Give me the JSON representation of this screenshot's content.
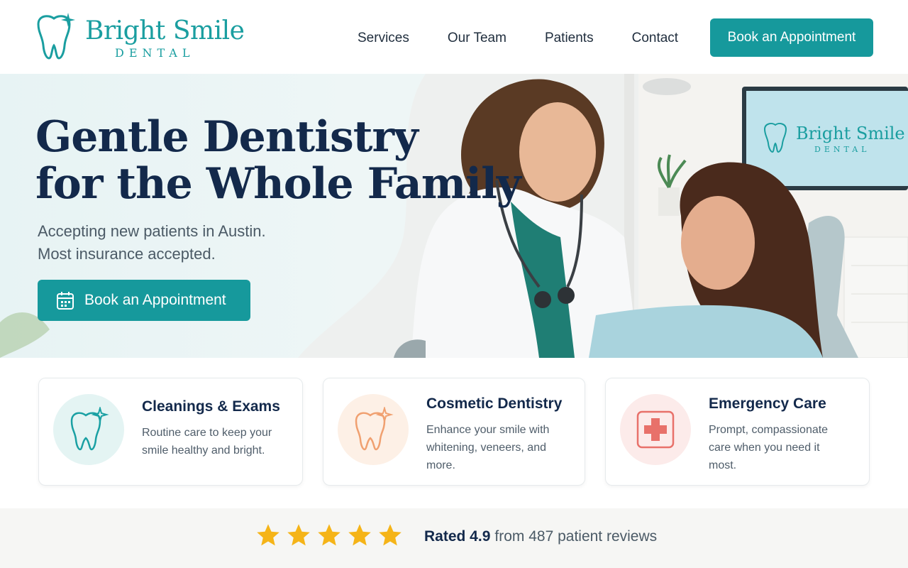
{
  "brand": {
    "name": "Bright Smile",
    "sub": "DENTAL",
    "accent": "#16999c"
  },
  "nav": {
    "items": [
      "Services",
      "Our Team",
      "Patients",
      "Contact"
    ],
    "cta": "Book an Appointment"
  },
  "hero": {
    "title_line1": "Gentle Dentistry",
    "title_line2": "for the Whole Family",
    "sub_line1": "Accepting new patients in Austin.",
    "sub_line2": "Most insurance accepted.",
    "cta": "Book an Appointment",
    "monitor_brand": "Bright Smile",
    "monitor_sub": "DENTAL"
  },
  "services": [
    {
      "title": "Cleanings & Exams",
      "desc_line1": "Routine care to keep your",
      "desc_line2": "smile healthy and bright.",
      "desc_line3": "",
      "icon": "tooth-sparkle-icon",
      "color": "#1aa0a3",
      "bg": "#e4f4f3"
    },
    {
      "title": "Cosmetic Dentistry",
      "desc_line1": "Enhance your smile with",
      "desc_line2": "whitening, veneers, and",
      "desc_line3": "more.",
      "icon": "tooth-sparkle-icon",
      "color": "#f0a070",
      "bg": "#fdf0e6"
    },
    {
      "title": "Emergency Care",
      "desc_line1": "Prompt, compassionate",
      "desc_line2": "care when you need it",
      "desc_line3": "most.",
      "icon": "first-aid-icon",
      "color": "#e8716a",
      "bg": "#fcebea"
    }
  ],
  "rating": {
    "stars": 5,
    "label": "Rated 4.9",
    "detail": "from 487 patient reviews",
    "star_color": "#f5b418"
  }
}
